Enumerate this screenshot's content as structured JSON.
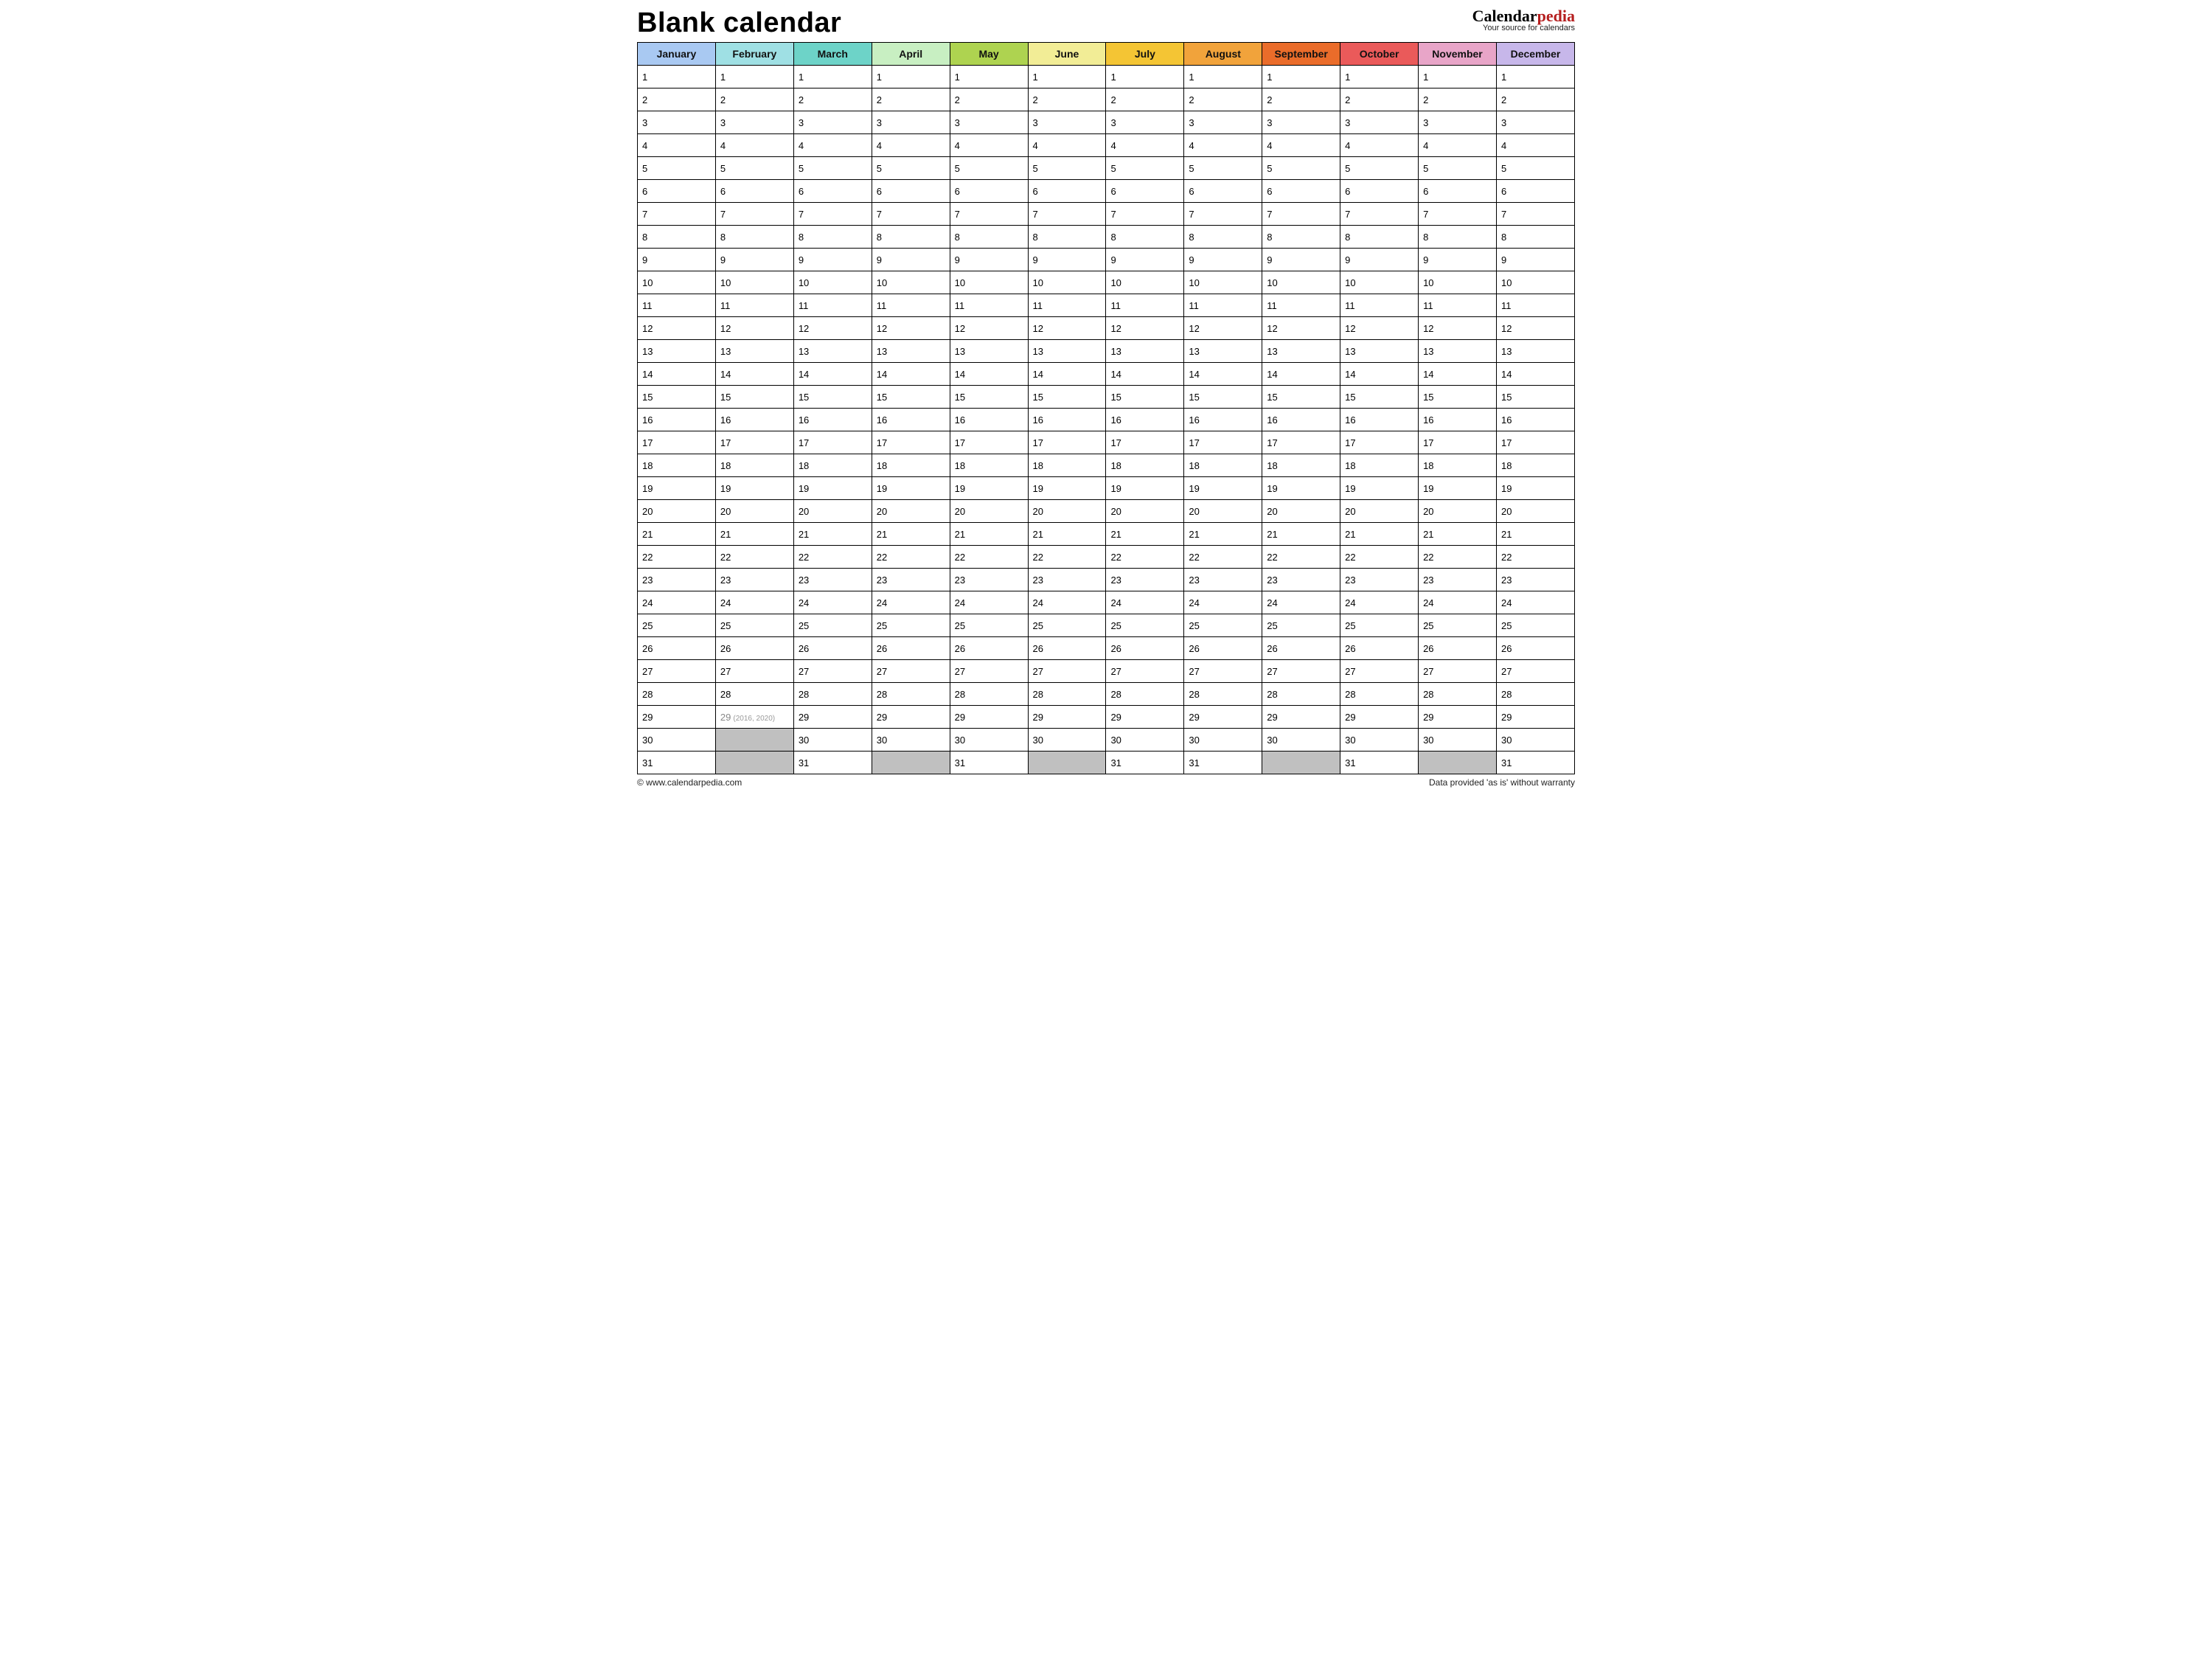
{
  "header": {
    "title": "Blank calendar",
    "brand_part1": "Calendar",
    "brand_part2": "pedia",
    "brand_tagline": "Your source for calendars"
  },
  "months": [
    {
      "name": "January",
      "color": "#a9c9f2",
      "days": 31
    },
    {
      "name": "February",
      "color": "#9fe0e4",
      "days": 29,
      "feb": true
    },
    {
      "name": "March",
      "color": "#6dd3c8",
      "days": 31
    },
    {
      "name": "April",
      "color": "#c8efc2",
      "days": 30
    },
    {
      "name": "May",
      "color": "#aed350",
      "days": 31
    },
    {
      "name": "June",
      "color": "#f2ed96",
      "days": 30
    },
    {
      "name": "July",
      "color": "#f4c534",
      "days": 31
    },
    {
      "name": "August",
      "color": "#f1a33b",
      "days": 31
    },
    {
      "name": "September",
      "color": "#ea6c2a",
      "days": 30
    },
    {
      "name": "October",
      "color": "#ea5a5a",
      "days": 31
    },
    {
      "name": "November",
      "color": "#e8a5c8",
      "days": 30
    },
    {
      "name": "December",
      "color": "#c7b7ea",
      "days": 31
    }
  ],
  "feb29_note": "(2016, 2020)",
  "max_rows": 31,
  "footer": {
    "left": "© www.calendarpedia.com",
    "right": "Data provided 'as is' without warranty"
  }
}
